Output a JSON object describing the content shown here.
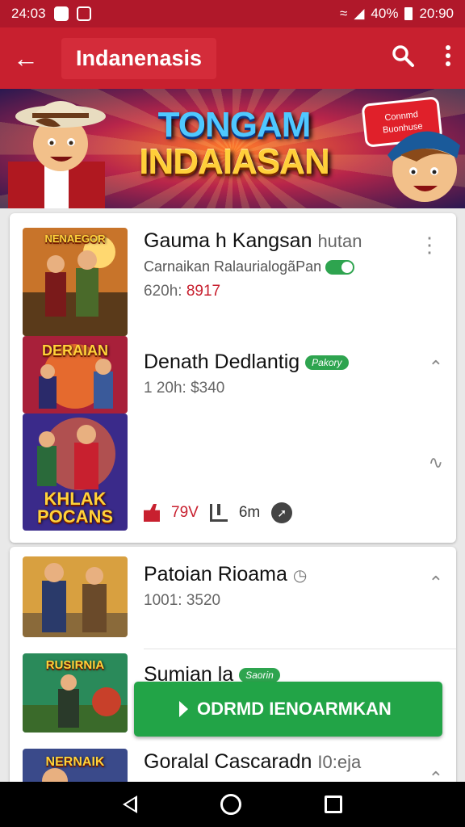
{
  "status_bar": {
    "time": "24:03",
    "battery": "40%",
    "clock_right": "20:90"
  },
  "app_bar": {
    "title": "Indanenasis"
  },
  "banner": {
    "title_line1": "TONGAM",
    "title_line2": "INDAIASAN",
    "bubble_line1": "Connmd",
    "bubble_line2": "Buonhuse"
  },
  "items": [
    {
      "thumb_label": "NENAEGOR",
      "title": "Gauma h Kangsan",
      "title_extra": "hutan",
      "subtitle": "Carnaikan RalaurialogãPan",
      "price_label": "620h:",
      "price_value": "8917"
    },
    {
      "thumb_label": "DERAIAN",
      "title": "Denath Dedlantig",
      "badge": "Pakory",
      "price": "1 20h: $340"
    },
    {
      "thumb_label": "KHLAK POCANS",
      "stats": {
        "count": "79V",
        "duration": "6m"
      }
    },
    {
      "title": "Patoian Rioama",
      "price": "1001: 3520"
    },
    {
      "thumb_label": "RUSIRNIA",
      "title": "Sumian la",
      "badge": "Saorin"
    },
    {
      "thumb_label": "NERNAIK",
      "title": "Goralal Cascaradn",
      "title_extra": "I0:eja"
    }
  ],
  "cta": {
    "label": "ODRMD IENOARMKAN"
  },
  "colors": {
    "primary": "#c8202f",
    "accent_green": "#22a447"
  }
}
